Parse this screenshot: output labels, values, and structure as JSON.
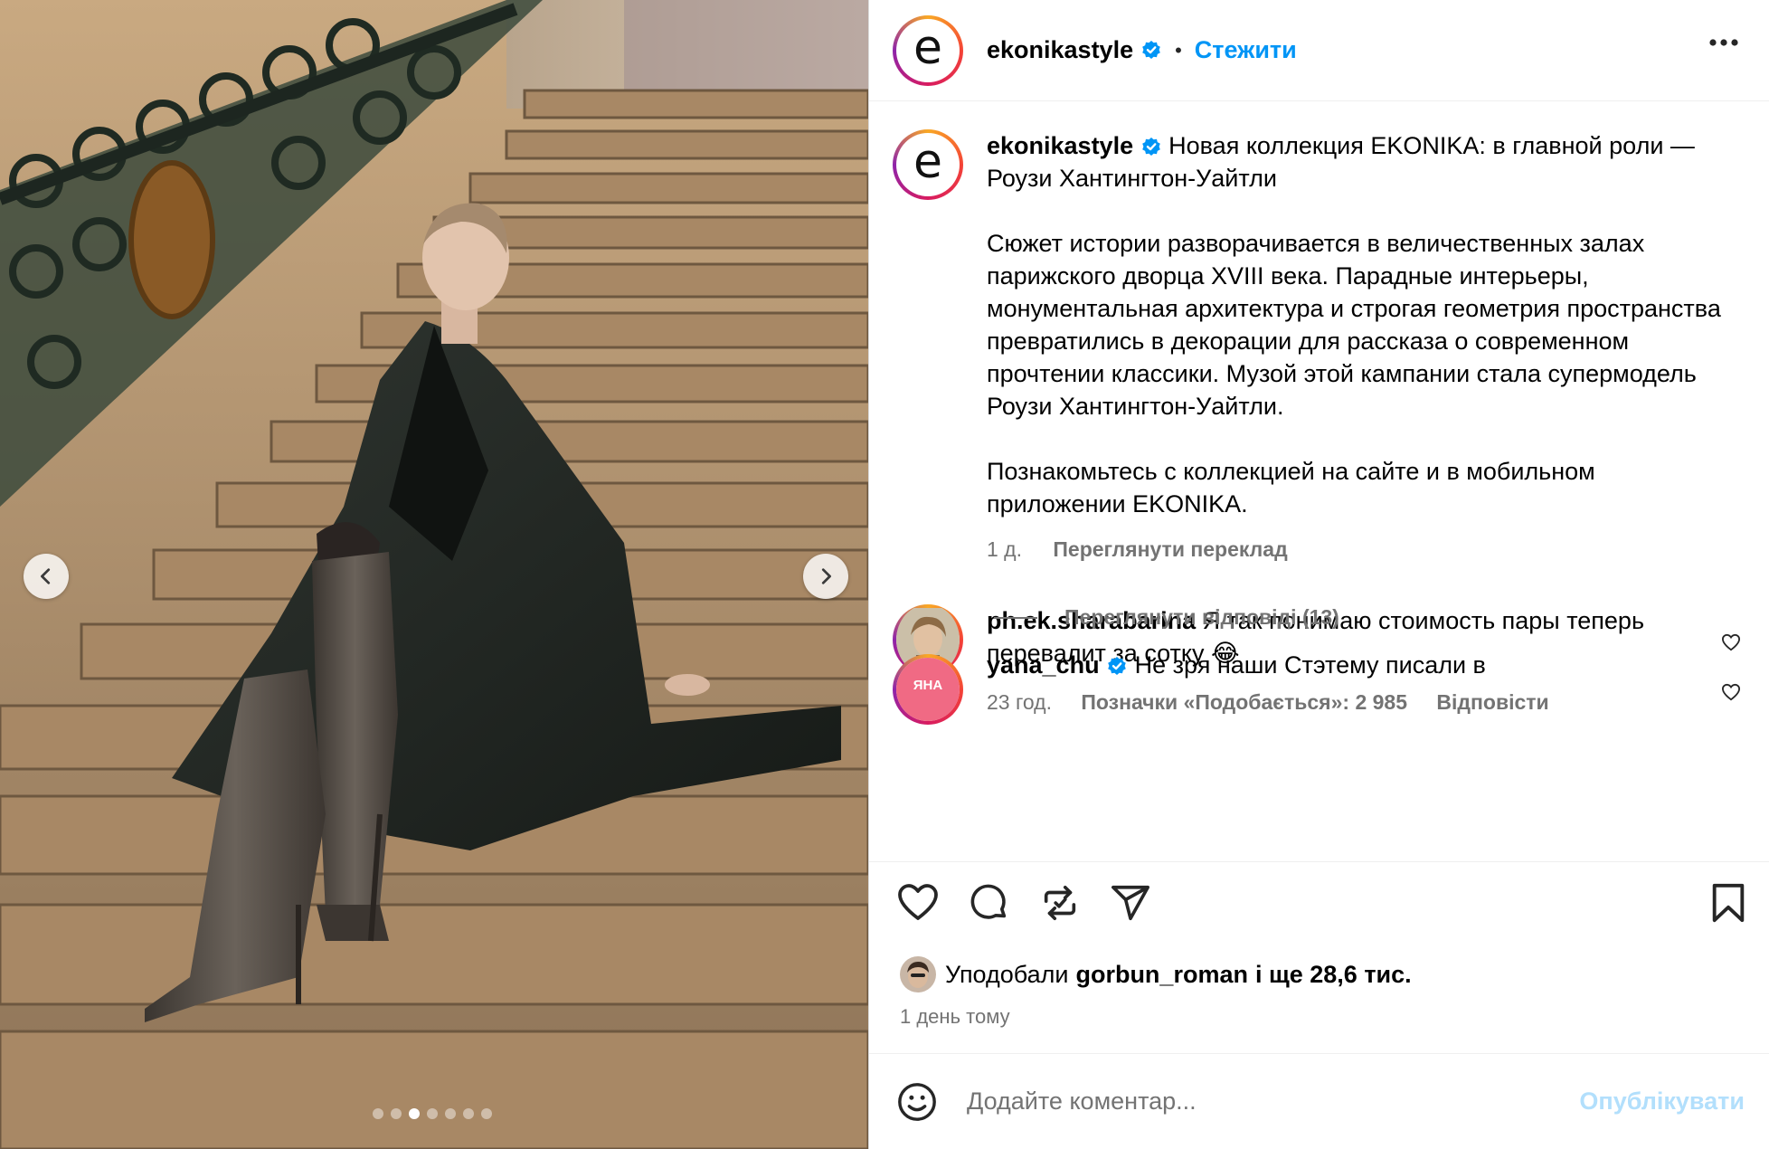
{
  "post": {
    "author": "ekonikastyle",
    "avatar_letter": "e",
    "follow_label": "Стежити",
    "separator": "•",
    "caption": {
      "lead": "Новая коллекция EKONIKA: в главной роли — Роузи Хантингтон-Уайтли",
      "paragraph_1": "Сюжет истории разворачивается в величественных залах парижского дворца XVIII века. Парадные интерьеры, монументальная архитектура и строгая геометрия пространства превратились в декорации для рассказа о современном прочтении классики. Музой этой кампании стала супермодель Роузи Хантингтон-Уайтли.",
      "paragraph_2": "Познакомьтесь с коллекцией на сайте и в мобильном приложении EKONIKA.",
      "time": "1 д.",
      "translate_label": "Переглянути переклад"
    },
    "carousel": {
      "slide_count": 7,
      "active_index": 2
    }
  },
  "comments": [
    {
      "author": "ph.ek.sharabarina",
      "text": "Я так понимаю стоимость пары теперь перевалит за сотку 😂",
      "time": "23 год.",
      "likes_label": "Позначки «Подобається»: 2 985",
      "reply_label": "Відповісти",
      "view_replies_label": "Переглянути відповіді (13)"
    },
    {
      "author": "yana_chu",
      "avatar_text": "ЯНА",
      "text": "Не зря наши Стэтему писали в"
    }
  ],
  "engagement": {
    "liked_prefix": "Уподобали",
    "liked_by": "gorbun_roman",
    "liked_suffix": "і ще 28,6 тис.",
    "date": "1 день тому"
  },
  "composer": {
    "placeholder": "Додайте коментар...",
    "post_label": "Опублікувати"
  },
  "colors": {
    "accent": "#0095f6",
    "post_disabled": "#b2dffc",
    "secondary_text": "#737373",
    "verified": "#0095f6"
  },
  "icons": [
    "chevron-left-icon",
    "chevron-right-icon",
    "more-icon",
    "verified-icon",
    "heart-icon",
    "comment-icon",
    "repost-icon",
    "share-icon",
    "bookmark-icon",
    "emoji-icon"
  ]
}
